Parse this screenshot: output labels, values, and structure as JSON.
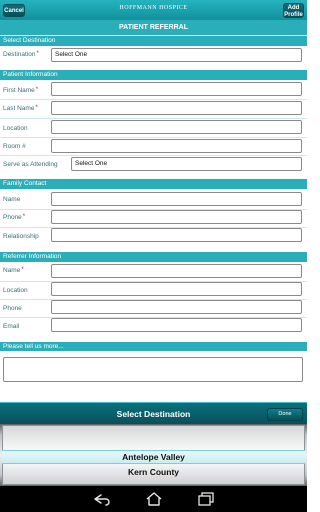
{
  "app": {
    "brand": "HOFFMANN HOSPICE",
    "cancel_label": "Cancel",
    "add_profile_label": "Add Profile",
    "page_title": "PATIENT REFERRAL"
  },
  "sections": {
    "destination": {
      "header": "Select Destination",
      "destination_label": "Destination",
      "destination_value": "Select One"
    },
    "patient": {
      "header": "Patient Information",
      "first_name_label": "First Name",
      "last_name_label": "Last Name",
      "location_label": "Location",
      "room_label": "Room #",
      "serve_label": "Serve as Attending",
      "serve_value": "Select One"
    },
    "family": {
      "header": "Family Contact",
      "name_label": "Name",
      "phone_label": "Phone",
      "relationship_label": "Relationship"
    },
    "referrer": {
      "header": "Referrer Information",
      "name_label": "Name",
      "location_label": "Location",
      "phone_label": "Phone",
      "email_label": "Email"
    },
    "tell_us": {
      "header": "Please tell us more..."
    }
  },
  "picker": {
    "title": "Select Destination",
    "done_label": "Done",
    "options": [
      "Antelope Valley",
      "Kern County"
    ],
    "selected": "Antelope Valley"
  },
  "required_marker": "*",
  "nav": {
    "icons": [
      "back-icon",
      "home-icon",
      "recent-apps-icon"
    ]
  },
  "colors": {
    "accent": "#2aafba",
    "dark_teal": "#07505a",
    "label_text": "#3c6e74",
    "required": "#b42020"
  }
}
